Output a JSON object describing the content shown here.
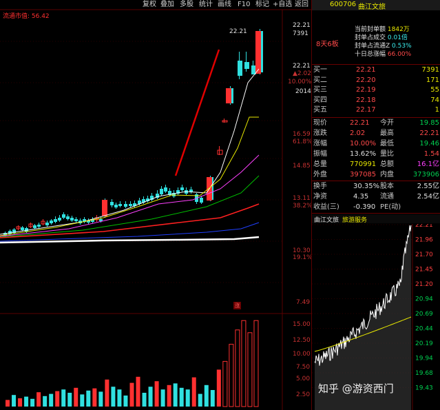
{
  "toolbar": {
    "items": [
      "复权",
      "叠加",
      "多股",
      "统计",
      "画线",
      "F10",
      "标记",
      "+自选",
      "返回"
    ],
    "indicator_label": "流通市值: 56.42",
    "price_marker": "22.21"
  },
  "left_axis": {
    "price_labels": [
      "22.21",
      "7391",
      "22.21",
      "▲2.02",
      "10.00%",
      "2014",
      "16.59",
      "61.8%",
      "14.85",
      "13.11",
      "38.2%",
      "10.30",
      "19.1%",
      "7.49"
    ],
    "volume_labels": [
      "15.00",
      "12.50",
      "10.00",
      "7.50",
      "5.00",
      "2.50"
    ],
    "marker_glyph": "涨"
  },
  "header": {
    "code": "600706",
    "name": "曲江文旅",
    "board": "8天6板",
    "stats": [
      {
        "label": "当前封单额",
        "value": "1842万"
      },
      {
        "label": "封单占成交",
        "value": "0.01倍"
      },
      {
        "label": "封单占流通Z",
        "value": "0.53%"
      },
      {
        "label": "十日总涨幅",
        "value": "66.00%"
      }
    ]
  },
  "order_book": [
    {
      "label": "买一",
      "price": "22.21",
      "vol": "7391"
    },
    {
      "label": "买二",
      "price": "22.20",
      "vol": "171"
    },
    {
      "label": "买三",
      "price": "22.19",
      "vol": "55"
    },
    {
      "label": "买四",
      "price": "22.18",
      "vol": "74"
    },
    {
      "label": "买五",
      "price": "22.17",
      "vol": "1"
    }
  ],
  "quote": [
    {
      "l1": "现价",
      "v1": "22.21",
      "l2": "今开",
      "v2": "19.85"
    },
    {
      "l1": "涨跌",
      "v1": "2.02",
      "l2": "最高",
      "v2": "22.21"
    },
    {
      "l1": "涨幅",
      "v1": "10.00%",
      "l2": "最低",
      "v2": "19.46"
    },
    {
      "l1": "振幅",
      "v1": "13.62%",
      "l2": "量比",
      "v2": "1.54"
    },
    {
      "l1": "总量",
      "v1": "770991",
      "l2": "总额",
      "v2": "16.1亿"
    },
    {
      "l1": "外盘",
      "v1": "397085",
      "l2": "内盘",
      "v2": "373906"
    }
  ],
  "fundamentals": [
    {
      "l1": "换手",
      "v1": "30.35%",
      "l2": "股本",
      "v2": "2.55亿"
    },
    {
      "l1": "净资",
      "v1": "4.35",
      "l2": "流通",
      "v2": "2.54亿"
    },
    {
      "l1": "收益(三)",
      "v1": "-0.390",
      "l2": "PE(动)",
      "v2": ""
    }
  ],
  "intraday": {
    "title": "曲江文旅",
    "tab": "旅游服务",
    "y_labels": [
      "22.21",
      "21.96",
      "21.70",
      "21.45",
      "21.20",
      "20.94",
      "20.69",
      "20.44",
      "20.19",
      "19.94",
      "19.68",
      "19.43"
    ]
  },
  "watermark": "知乎 @游资西门",
  "colors": {
    "up": "#ff3030",
    "down": "#30e0e0",
    "ma5": "#ffffff",
    "ma10": "#e8e800",
    "ma20": "#ff40ff",
    "ma60": "#00c000",
    "ma120": "#ff2020",
    "ma250": "#2040ff"
  },
  "chart_data": {
    "type": "candlestick",
    "volume": [
      1.2,
      2.1,
      1.5,
      1.8,
      1.4,
      2.6,
      1.9,
      2.3,
      2.8,
      3.1,
      2.5,
      3.4,
      2.2,
      2.9,
      3.3,
      2.7,
      4.9,
      3.6,
      3.1,
      2.0,
      4.3,
      5.4,
      2.5,
      3.6,
      4.6,
      3.1,
      3.9,
      4.2,
      3.4,
      3.1,
      5.3,
      2.3,
      3.9,
      3.0,
      6.7,
      8.2,
      11.3,
      13.9,
      15.6,
      13.4,
      15.6
    ]
  }
}
